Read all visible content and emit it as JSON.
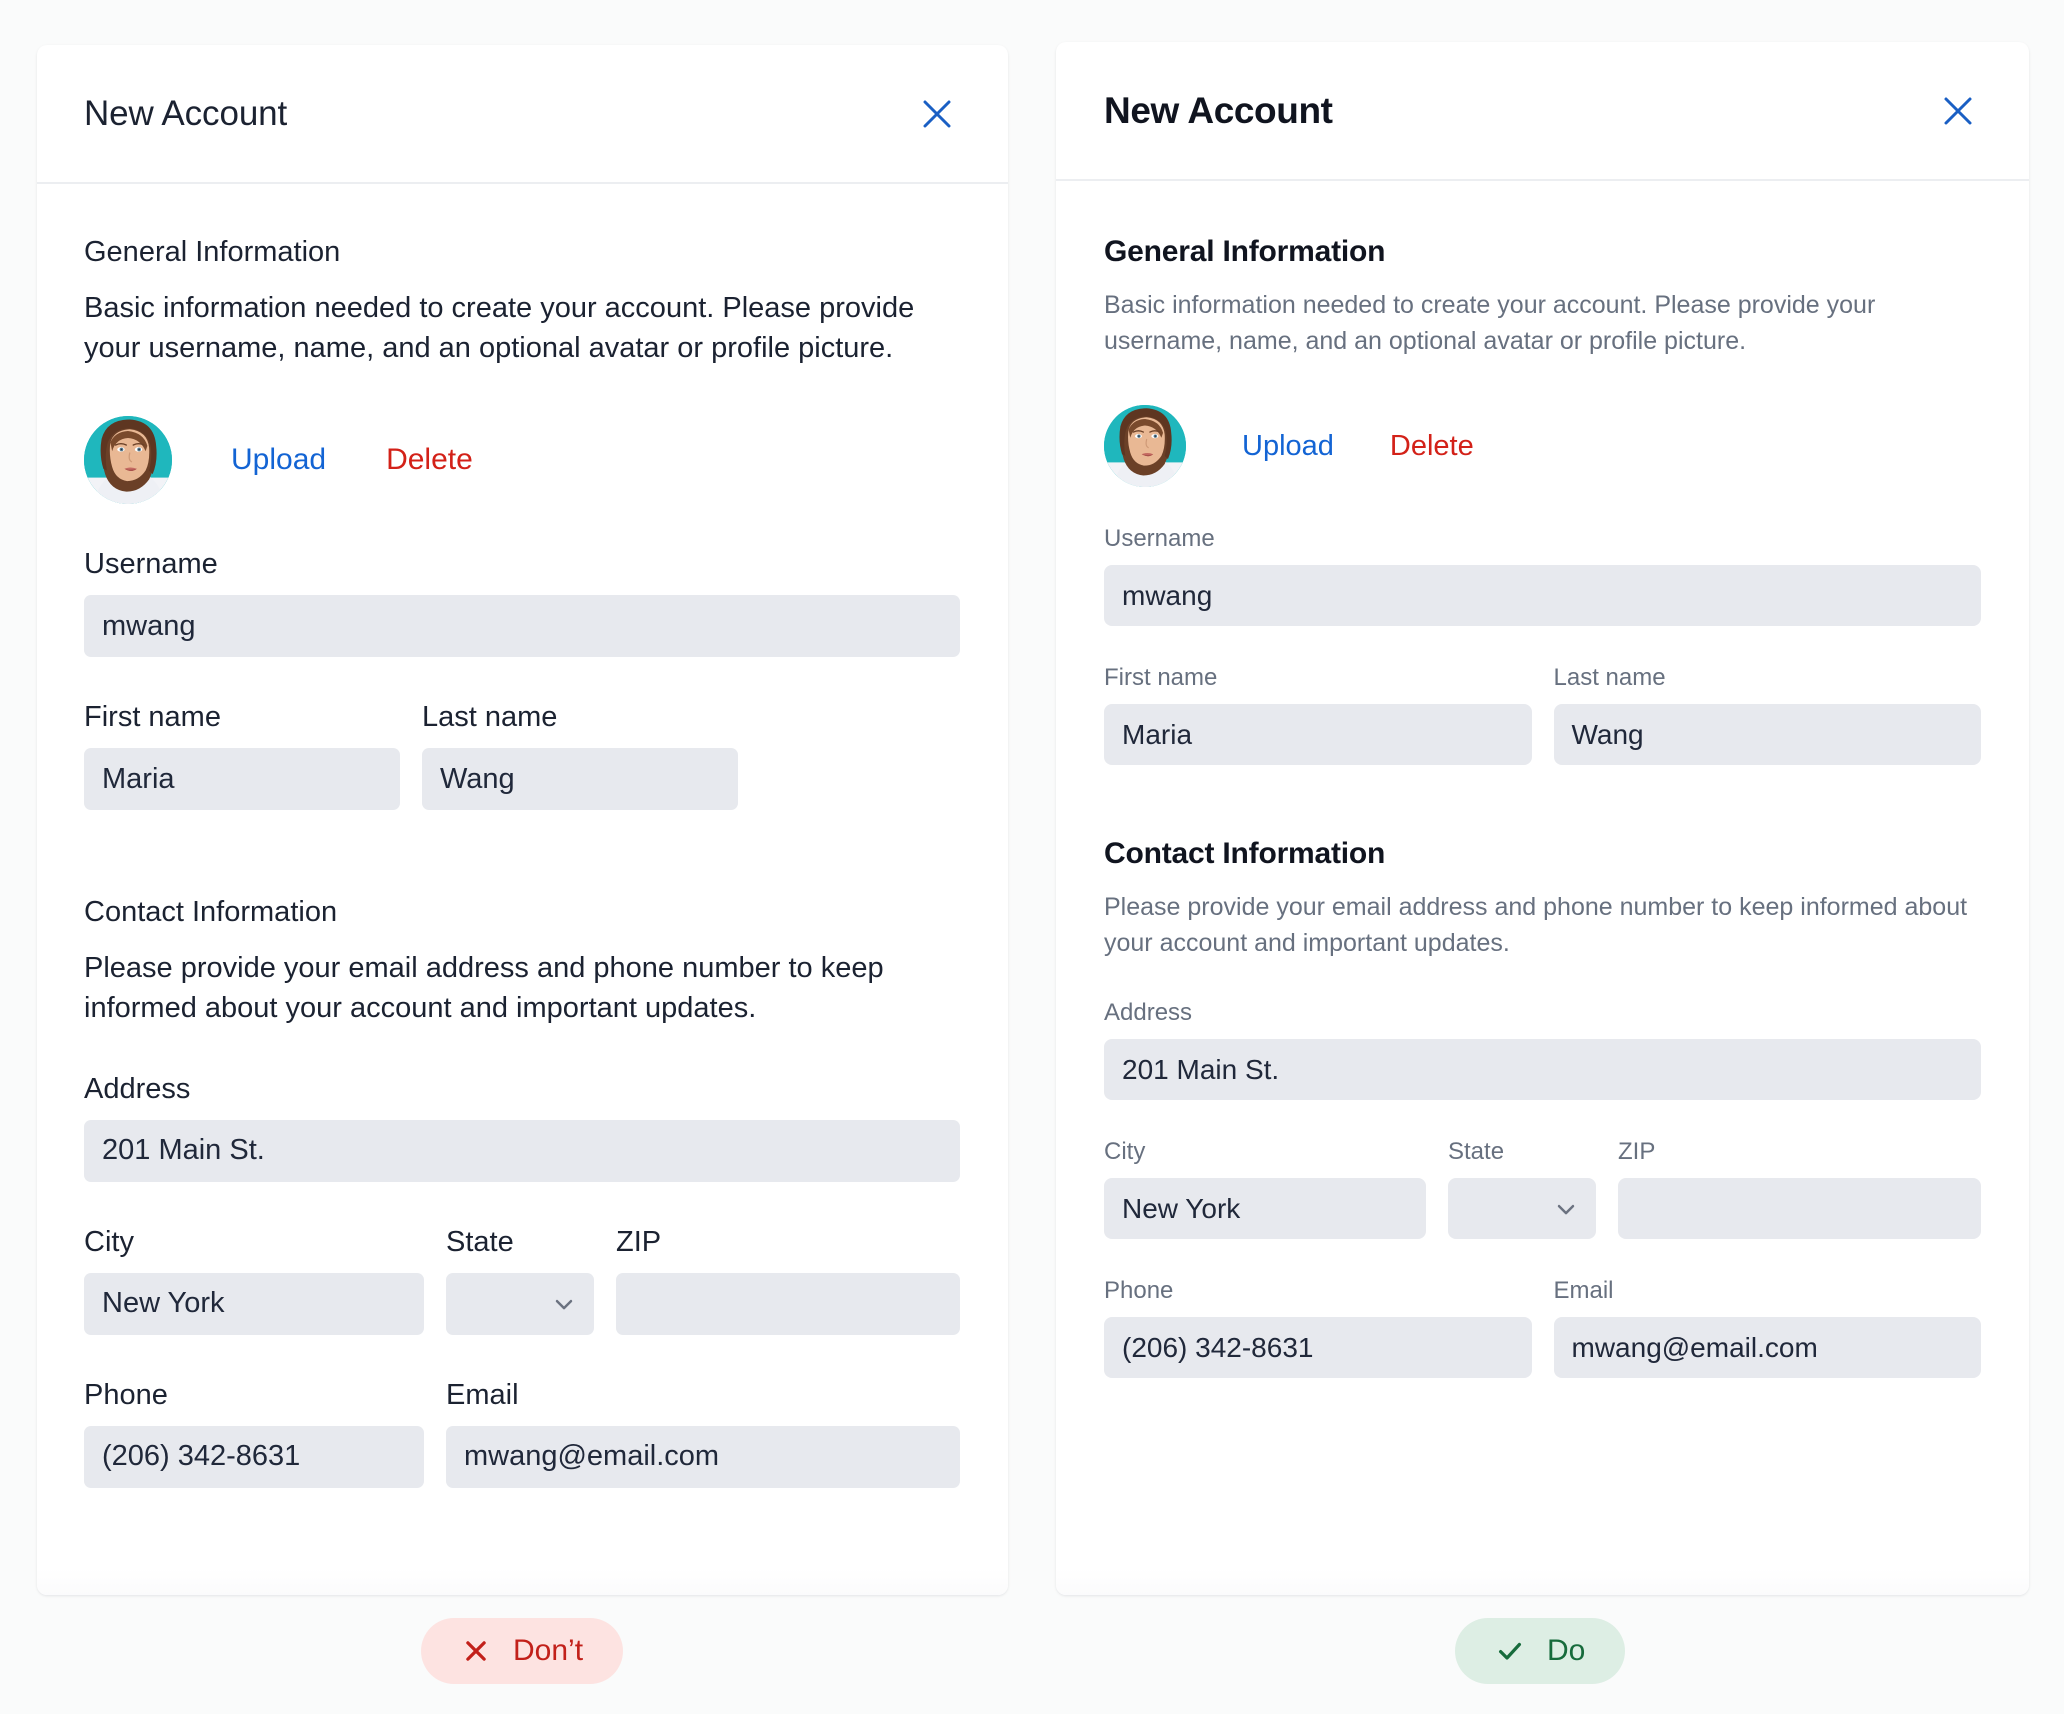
{
  "comparison": {
    "dont": {
      "label": "Don’t",
      "icon": "close-x-icon",
      "bg": "#fde3e1",
      "fg": "#c2201a"
    },
    "do": {
      "label": "Do",
      "icon": "check-icon",
      "bg": "#ddeee4",
      "fg": "#176b3c"
    }
  },
  "colors": {
    "link_blue": "#1364d4",
    "link_red": "#d32118",
    "close_blue": "#1a5fc4",
    "input_bg": "#e7e9ee",
    "muted_text": "#67707f",
    "heading_text": "#10141f",
    "page_bg": "#fafbfb",
    "avatar_bg": "#1fb7bd"
  },
  "dialog": {
    "title": "New Account",
    "close_icon": "close-x-icon",
    "sections": {
      "general": {
        "title": "General Information",
        "description": "Basic information needed to create your account. Please provide your username, name, and an optional avatar or profile picture.",
        "avatar": {
          "alt": "avatar",
          "upload_label": "Upload",
          "delete_label": "Delete"
        },
        "fields": {
          "username": {
            "label": "Username",
            "value": "mwang"
          },
          "first_name": {
            "label": "First name",
            "value": "Maria"
          },
          "last_name": {
            "label": "Last name",
            "value": "Wang"
          }
        }
      },
      "contact": {
        "title": "Contact Information",
        "description": "Please provide your email address and phone number to keep informed about your account and important updates.",
        "fields": {
          "address": {
            "label": "Address",
            "value": "201 Main St."
          },
          "city": {
            "label": "City",
            "value": "New York"
          },
          "state": {
            "label": "State",
            "value": "",
            "icon": "chevron-down-icon"
          },
          "zip": {
            "label": "ZIP",
            "value": ""
          },
          "phone": {
            "label": "Phone",
            "value": "(206) 342-8631"
          },
          "email": {
            "label": "Email",
            "value": "mwang@email.com"
          }
        }
      }
    }
  }
}
